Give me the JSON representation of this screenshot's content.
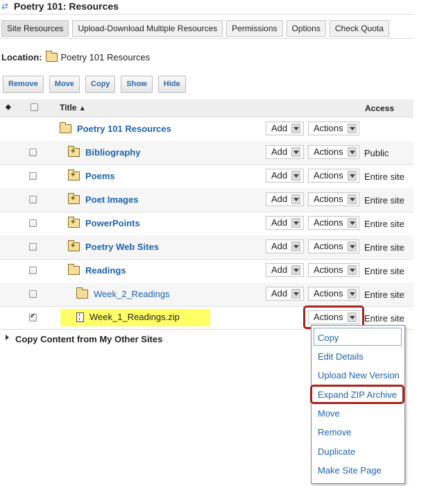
{
  "header": {
    "icon": "sakai-resources-icon",
    "title": "Poetry 101: Resources"
  },
  "tabs": [
    {
      "label": "Site Resources"
    },
    {
      "label": "Upload-Download Multiple Resources"
    },
    {
      "label": "Permissions"
    },
    {
      "label": "Options"
    },
    {
      "label": "Check Quota"
    }
  ],
  "location": {
    "label": "Location:",
    "value": "Poetry 101 Resources"
  },
  "actions": {
    "remove": "Remove",
    "move": "Move",
    "copy": "Copy",
    "show": "Show",
    "hide": "Hide"
  },
  "table": {
    "col_title": "Title",
    "col_access": "Access",
    "add_label": "Add",
    "actions_label": "Actions",
    "rows": [
      {
        "name": "Poetry 101 Resources",
        "access": ""
      },
      {
        "name": "Bibliography",
        "access": "Public"
      },
      {
        "name": "Poems",
        "access": "Entire site"
      },
      {
        "name": "Poet Images",
        "access": "Entire site"
      },
      {
        "name": "PowerPoints",
        "access": "Entire site"
      },
      {
        "name": "Poetry Web Sites",
        "access": "Entire site"
      },
      {
        "name": "Readings",
        "access": "Entire site"
      },
      {
        "name": "Week_2_Readings",
        "access": "Entire site"
      },
      {
        "name": "Week_1_Readings.zip",
        "access": "Entire site"
      }
    ]
  },
  "copy_other": {
    "label": "Copy Content from My Other Sites"
  },
  "menu": {
    "items": [
      "Copy",
      "Edit Details",
      "Upload New Version",
      "Expand ZIP Archive",
      "Move",
      "Remove",
      "Duplicate",
      "Make Site Page"
    ]
  },
  "colors": {
    "link": "#1d63b0",
    "highlight": "#ffff66",
    "callout": "#a8231e"
  }
}
